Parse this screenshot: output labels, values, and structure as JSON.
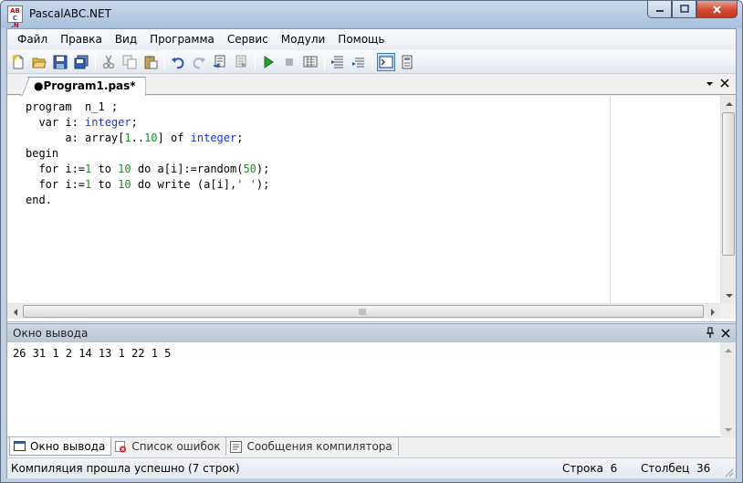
{
  "window": {
    "title": "PascalABC.NET",
    "icon_name": "pascalabc-app-icon",
    "controls": {
      "minimize": "minimize-icon",
      "maximize": "maximize-icon",
      "close": "close-icon"
    }
  },
  "menu": {
    "items": [
      "Файл",
      "Правка",
      "Вид",
      "Программа",
      "Сервис",
      "Модули",
      "Помощь"
    ]
  },
  "toolbar": {
    "icons": [
      "new-file-icon",
      "open-folder-icon",
      "save-icon",
      "save-all-icon",
      "cut-icon",
      "copy-icon",
      "paste-icon",
      "undo-icon",
      "redo-icon",
      "compile-icon",
      "build-icon",
      "run-icon",
      "stop-icon",
      "debug-icon",
      "step-into-icon",
      "step-over-icon",
      "output-window-icon",
      "form-designer-icon"
    ]
  },
  "document": {
    "tab_label": "●Program1.pas*"
  },
  "editor": {
    "lines": [
      [
        {
          "t": "program  n_1 ;",
          "c": ""
        }
      ],
      [
        {
          "t": "  var i: ",
          "c": ""
        },
        {
          "t": "integer",
          "c": "kw-blue"
        },
        {
          "t": ";",
          "c": ""
        }
      ],
      [
        {
          "t": "      a: array[",
          "c": ""
        },
        {
          "t": "1",
          "c": "num"
        },
        {
          "t": "..",
          "c": ""
        },
        {
          "t": "10",
          "c": "num"
        },
        {
          "t": "] of ",
          "c": ""
        },
        {
          "t": "integer",
          "c": "kw-blue"
        },
        {
          "t": ";",
          "c": ""
        }
      ],
      [
        {
          "t": "begin",
          "c": ""
        }
      ],
      [
        {
          "t": "  for i:=",
          "c": ""
        },
        {
          "t": "1",
          "c": "num"
        },
        {
          "t": " to ",
          "c": ""
        },
        {
          "t": "10",
          "c": "num"
        },
        {
          "t": " do a[i]:=random(",
          "c": ""
        },
        {
          "t": "50",
          "c": "num"
        },
        {
          "t": ");",
          "c": ""
        }
      ],
      [
        {
          "t": "  for i:=",
          "c": ""
        },
        {
          "t": "1",
          "c": "num"
        },
        {
          "t": " to ",
          "c": ""
        },
        {
          "t": "10",
          "c": "num"
        },
        {
          "t": " do write (a[i],",
          "c": ""
        },
        {
          "t": "' '",
          "c": "str"
        },
        {
          "t": ");",
          "c": ""
        }
      ],
      [
        {
          "t": "end.",
          "c": ""
        }
      ]
    ],
    "colors": {
      "keyword_type": "#1d37d0",
      "number": "#1f8a2e",
      "string": "#1d37d0"
    }
  },
  "output": {
    "title": "Окно вывода",
    "text": "26 31 1 2 14 13 1 22 1 5",
    "pin_icon": "pin-icon",
    "close_icon": "close-icon"
  },
  "bottom_tabs": [
    {
      "label": "Окно вывода",
      "icon": "output-window-icon",
      "active": true
    },
    {
      "label": "Список ошибок",
      "icon": "error-list-icon",
      "active": false
    },
    {
      "label": "Сообщения компилятора",
      "icon": "compiler-messages-icon",
      "active": false
    }
  ],
  "status": {
    "message": "Компиляция прошла успешно (7 строк)",
    "row_label": "Строка",
    "row_value": "6",
    "col_label": "Столбец",
    "col_value": "36"
  }
}
